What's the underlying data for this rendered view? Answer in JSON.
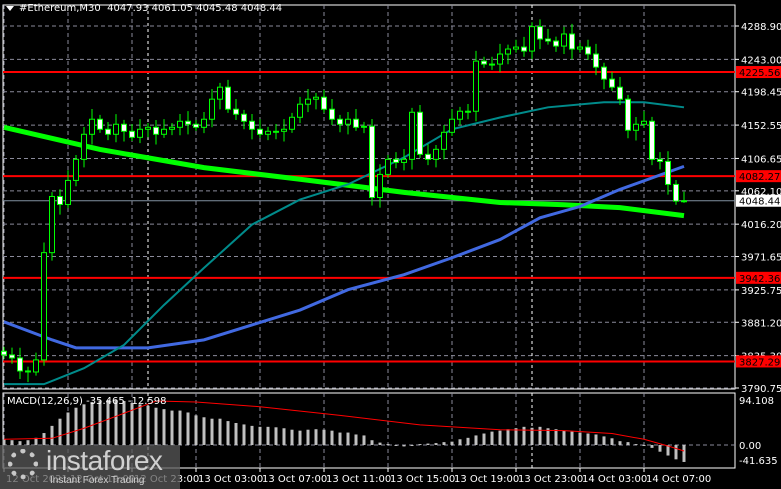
{
  "header": {
    "symbol": "#Ethereum,M30",
    "open": "4047.93",
    "high": "4061.05",
    "low": "4045.48",
    "close": "4048.44"
  },
  "macd_header": "MACD(12,26,9) -35.465 -12.598",
  "watermark": {
    "brand": "instaforex",
    "tagline": "Instant Forex Trading"
  },
  "colors": {
    "background": "#000000",
    "candle": "#00ff00",
    "bull_body": "#000000",
    "bear_body": "#ffffff",
    "ma_slow": "#00ff00",
    "ma_mid": "#4169e1",
    "ma_fast": "#008b8b",
    "level": "#ff0000",
    "histogram": "#c0c0c0",
    "signal": "#ff0000",
    "grid": "#8a8a9a"
  },
  "chart_data": [
    {
      "type": "candlestick",
      "title": "#Ethereum,M30",
      "ylim": [
        3790.75,
        4288.9
      ],
      "y_ticks": [
        "4288.90",
        "4243.00",
        "4198.45",
        "4152.55",
        "4106.65",
        "4062.10",
        "4016.20",
        "3971.65",
        "3925.75",
        "3881.20",
        "3835.30",
        "3790.75"
      ],
      "x_labels": [
        {
          "candle": 0,
          "label": "12 Oct 2021"
        },
        {
          "candle": 8,
          "label": "12 Oct 19:00"
        },
        {
          "candle": 16,
          "label": "12 Oct 23:00"
        },
        {
          "candle": 24,
          "label": "13 Oct 03:00"
        },
        {
          "candle": 32,
          "label": "13 Oct 07:00"
        },
        {
          "candle": 40,
          "label": "13 Oct 11:00"
        },
        {
          "candle": 48,
          "label": "13 Oct 15:00"
        },
        {
          "candle": 56,
          "label": "13 Oct 19:00"
        },
        {
          "candle": 64,
          "label": "13 Oct 23:00"
        },
        {
          "candle": 72,
          "label": "14 Oct 03:00"
        },
        {
          "candle": 80,
          "label": "14 Oct 07:00"
        }
      ],
      "day_separators": [
        18,
        66
      ],
      "closes": [
        3836.3,
        3832.1,
        3814.2,
        3812.8,
        3829.4,
        3977.0,
        4054.3,
        4043.3,
        4076.4,
        4105.4,
        4139.9,
        4160.6,
        4146.8,
        4139.9,
        4153.7,
        4144.0,
        4135.7,
        4146.8,
        4149.5,
        4139.9,
        4146.8,
        4149.5,
        4157.8,
        4153.7,
        4149.5,
        4160.6,
        4188.2,
        4204.7,
        4174.4,
        4167.5,
        4157.8,
        4146.8,
        4139.9,
        4144.0,
        4144.0,
        4146.8,
        4163.3,
        4181.3,
        4188.2,
        4190.9,
        4174.4,
        4160.6,
        4153.7,
        4160.6,
        4149.5,
        4150.9,
        4052.9,
        4084.7,
        4105.4,
        4101.2,
        4105.4,
        4170.2,
        4112.3,
        4105.4,
        4119.2,
        4142.6,
        4160.6,
        4171.6,
        4171.6,
        4240.6,
        4236.5,
        4236.5,
        4250.3,
        4257.2,
        4259.9,
        4254.4,
        4288.0,
        4271.0,
        4268.2,
        4261.3,
        4277.9,
        4257.2,
        4259.9,
        4250.3,
        4232.3,
        4215.8,
        4204.7,
        4188.2,
        4145.4,
        4153.7,
        4157.8,
        4105.4,
        4102.6,
        4070.9,
        4047.93,
        4048.44
      ],
      "last_candle": {
        "open": 4047.93,
        "high": 4061.05,
        "low": 4045.48,
        "close": 4048.44
      },
      "current_price": "4048.44",
      "levels": [
        "4225.56",
        "4082.27",
        "3942.36",
        "3827.29"
      ],
      "moving_averages": [
        {
          "color": "#00ff00",
          "points": [
            [
              0,
              4149.5
            ],
            [
              12,
              4119
            ],
            [
              25,
              4094
            ],
            [
              37,
              4078
            ],
            [
              50,
              4060
            ],
            [
              62,
              4046
            ],
            [
              70,
              4043
            ],
            [
              77,
              4039
            ],
            [
              85,
              4028
            ]
          ]
        },
        {
          "color": "#4169e1",
          "points": [
            [
              0,
              3881.8
            ],
            [
              6,
              3857
            ],
            [
              9,
              3846
            ],
            [
              18,
              3846
            ],
            [
              25,
              3857
            ],
            [
              31,
              3877.6
            ],
            [
              37,
              3898
            ],
            [
              43,
              3926
            ],
            [
              50,
              3946.7
            ],
            [
              56,
              3970
            ],
            [
              62,
              3995
            ],
            [
              67,
              4025
            ],
            [
              72,
              4040.5
            ],
            [
              77,
              4064
            ],
            [
              85,
              4095.7
            ]
          ]
        },
        {
          "color": "#008b8b",
          "points": [
            [
              0,
              3796
            ],
            [
              5,
              3796
            ],
            [
              10,
              3818
            ],
            [
              15,
              3850
            ],
            [
              20,
              3905
            ],
            [
              25,
              3956
            ],
            [
              31,
              4015.6
            ],
            [
              37,
              4050
            ],
            [
              43,
              4071
            ],
            [
              50,
              4108
            ],
            [
              56,
              4146.8
            ],
            [
              62,
              4163
            ],
            [
              68,
              4177
            ],
            [
              75,
              4184
            ],
            [
              80,
              4184
            ],
            [
              85,
              4177
            ]
          ]
        }
      ]
    },
    {
      "type": "bar",
      "title": "MACD(12,26,9)",
      "ylim": [
        -41.635,
        94.108
      ],
      "y_ticks": [
        "94.108",
        "0.00",
        "-41.635"
      ],
      "histogram": [
        12,
        10,
        8,
        10,
        15,
        25,
        40,
        55,
        68,
        78,
        85,
        90,
        93,
        94,
        94,
        92,
        88,
        85,
        82,
        78,
        75,
        72,
        72,
        68,
        62,
        58,
        55,
        55,
        50,
        46,
        43,
        40,
        38,
        38,
        37,
        35,
        32,
        30,
        32,
        33,
        32,
        30,
        26,
        26,
        22,
        20,
        10,
        5,
        2,
        -2,
        -3,
        -1,
        2,
        3,
        4,
        6,
        7,
        12,
        15,
        20,
        24,
        28,
        30,
        33,
        35,
        38,
        36,
        38,
        35,
        33,
        30,
        28,
        26,
        24,
        22,
        18,
        14,
        8,
        6,
        2,
        -2,
        -6,
        -14,
        -22,
        -30,
        -35.465
      ],
      "signal": [
        [
          0,
          12
        ],
        [
          6,
          14
        ],
        [
          10,
          35
        ],
        [
          14,
          60
        ],
        [
          19,
          92
        ],
        [
          24,
          90
        ],
        [
          32,
          80
        ],
        [
          42,
          62
        ],
        [
          52,
          42
        ],
        [
          62,
          32
        ],
        [
          70,
          30
        ],
        [
          76,
          24
        ],
        [
          80,
          12
        ],
        [
          83,
          -2
        ],
        [
          85,
          -12.598
        ]
      ]
    }
  ]
}
